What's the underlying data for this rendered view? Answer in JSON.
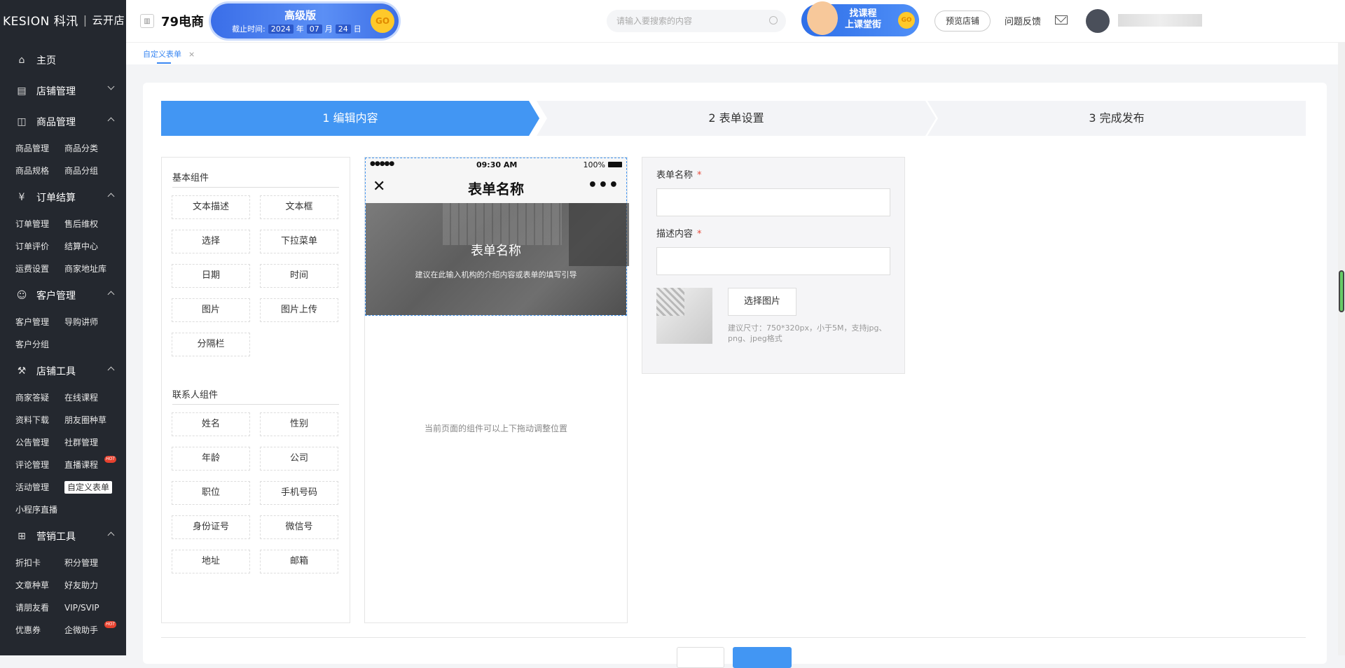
{
  "brand": {
    "logo": "KESION 科汛",
    "product": "云开店"
  },
  "sidebar": {
    "items": [
      {
        "label": "主页",
        "icon": "home-icon"
      },
      {
        "label": "店铺管理",
        "icon": "store-icon",
        "expanded": false
      },
      {
        "label": "商品管理",
        "icon": "bag-icon",
        "expanded": true,
        "children": [
          "商品管理",
          "商品分类",
          "商品规格",
          "商品分组"
        ]
      },
      {
        "label": "订单结算",
        "icon": "yen-icon",
        "expanded": true,
        "children": [
          "订单管理",
          "售后维权",
          "订单评价",
          "结算中心",
          "运费设置",
          "商家地址库"
        ]
      },
      {
        "label": "客户管理",
        "icon": "user-icon",
        "expanded": true,
        "children": [
          "客户管理",
          "导购讲师",
          "客户分组"
        ]
      },
      {
        "label": "店铺工具",
        "icon": "tool-icon",
        "expanded": true,
        "children": [
          "商家答疑",
          "在线课程",
          "资料下载",
          "朋友圈种草",
          "公告管理",
          "社群管理",
          "评论管理",
          "直播课程",
          "活动管理",
          "自定义表单",
          "小程序直播"
        ]
      },
      {
        "label": "营销工具",
        "icon": "gift-icon",
        "expanded": true,
        "children": [
          "折扣卡",
          "积分管理",
          "文章种草",
          "好友助力",
          "请朋友看",
          "VIP/SVIP",
          "优惠券",
          "企微助手"
        ]
      }
    ],
    "hot_badge": "HOT"
  },
  "topbar": {
    "store_name": "79电商",
    "banner": {
      "title": "高级版",
      "date_prefix": "截止时间:",
      "year": "2024",
      "year_unit": "年",
      "month": "07",
      "month_unit": "月",
      "day": "24",
      "day_unit": "日",
      "go": "GO"
    },
    "search_placeholder": "请输入要搜索的内容",
    "promo": {
      "line1": "找课程",
      "line2": "上课堂街",
      "go": "GO"
    },
    "preview_label": "预览店铺",
    "feedback_label": "问题反馈"
  },
  "tabs": [
    {
      "label": "自定义表单",
      "close": "×"
    }
  ],
  "steps": [
    "1 编辑内容",
    "2 表单设置",
    "3 完成发布"
  ],
  "components": {
    "basic_title": "基本组件",
    "basic": [
      "文本描述",
      "文本框",
      "选择",
      "下拉菜单",
      "日期",
      "时间",
      "图片",
      "图片上传",
      "分隔栏"
    ],
    "contact_title": "联系人组件",
    "contact": [
      "姓名",
      "性别",
      "年龄",
      "公司",
      "职位",
      "手机号码",
      "身份证号",
      "微信号",
      "地址",
      "邮箱"
    ]
  },
  "phone": {
    "signal": "●●●●●",
    "time": "09:30 AM",
    "battery": "100%",
    "close": "✕",
    "title": "表单名称",
    "more": "•••",
    "banner_title": "表单名称",
    "banner_desc": "建议在此输入机构的介绍内容或表单的填写引导",
    "hint": "当前页面的组件可以上下拖动调整位置"
  },
  "form": {
    "name_label": "表单名称",
    "desc_label": "描述内容",
    "required": "*",
    "pick_label": "选择图片",
    "pick_tip": "建议尺寸：750*320px，小于5M，支持jpg、png、jpeg格式"
  },
  "colors": {
    "primary": "#4296f3",
    "sidebar": "#24282f",
    "hot": "#e7412e"
  }
}
